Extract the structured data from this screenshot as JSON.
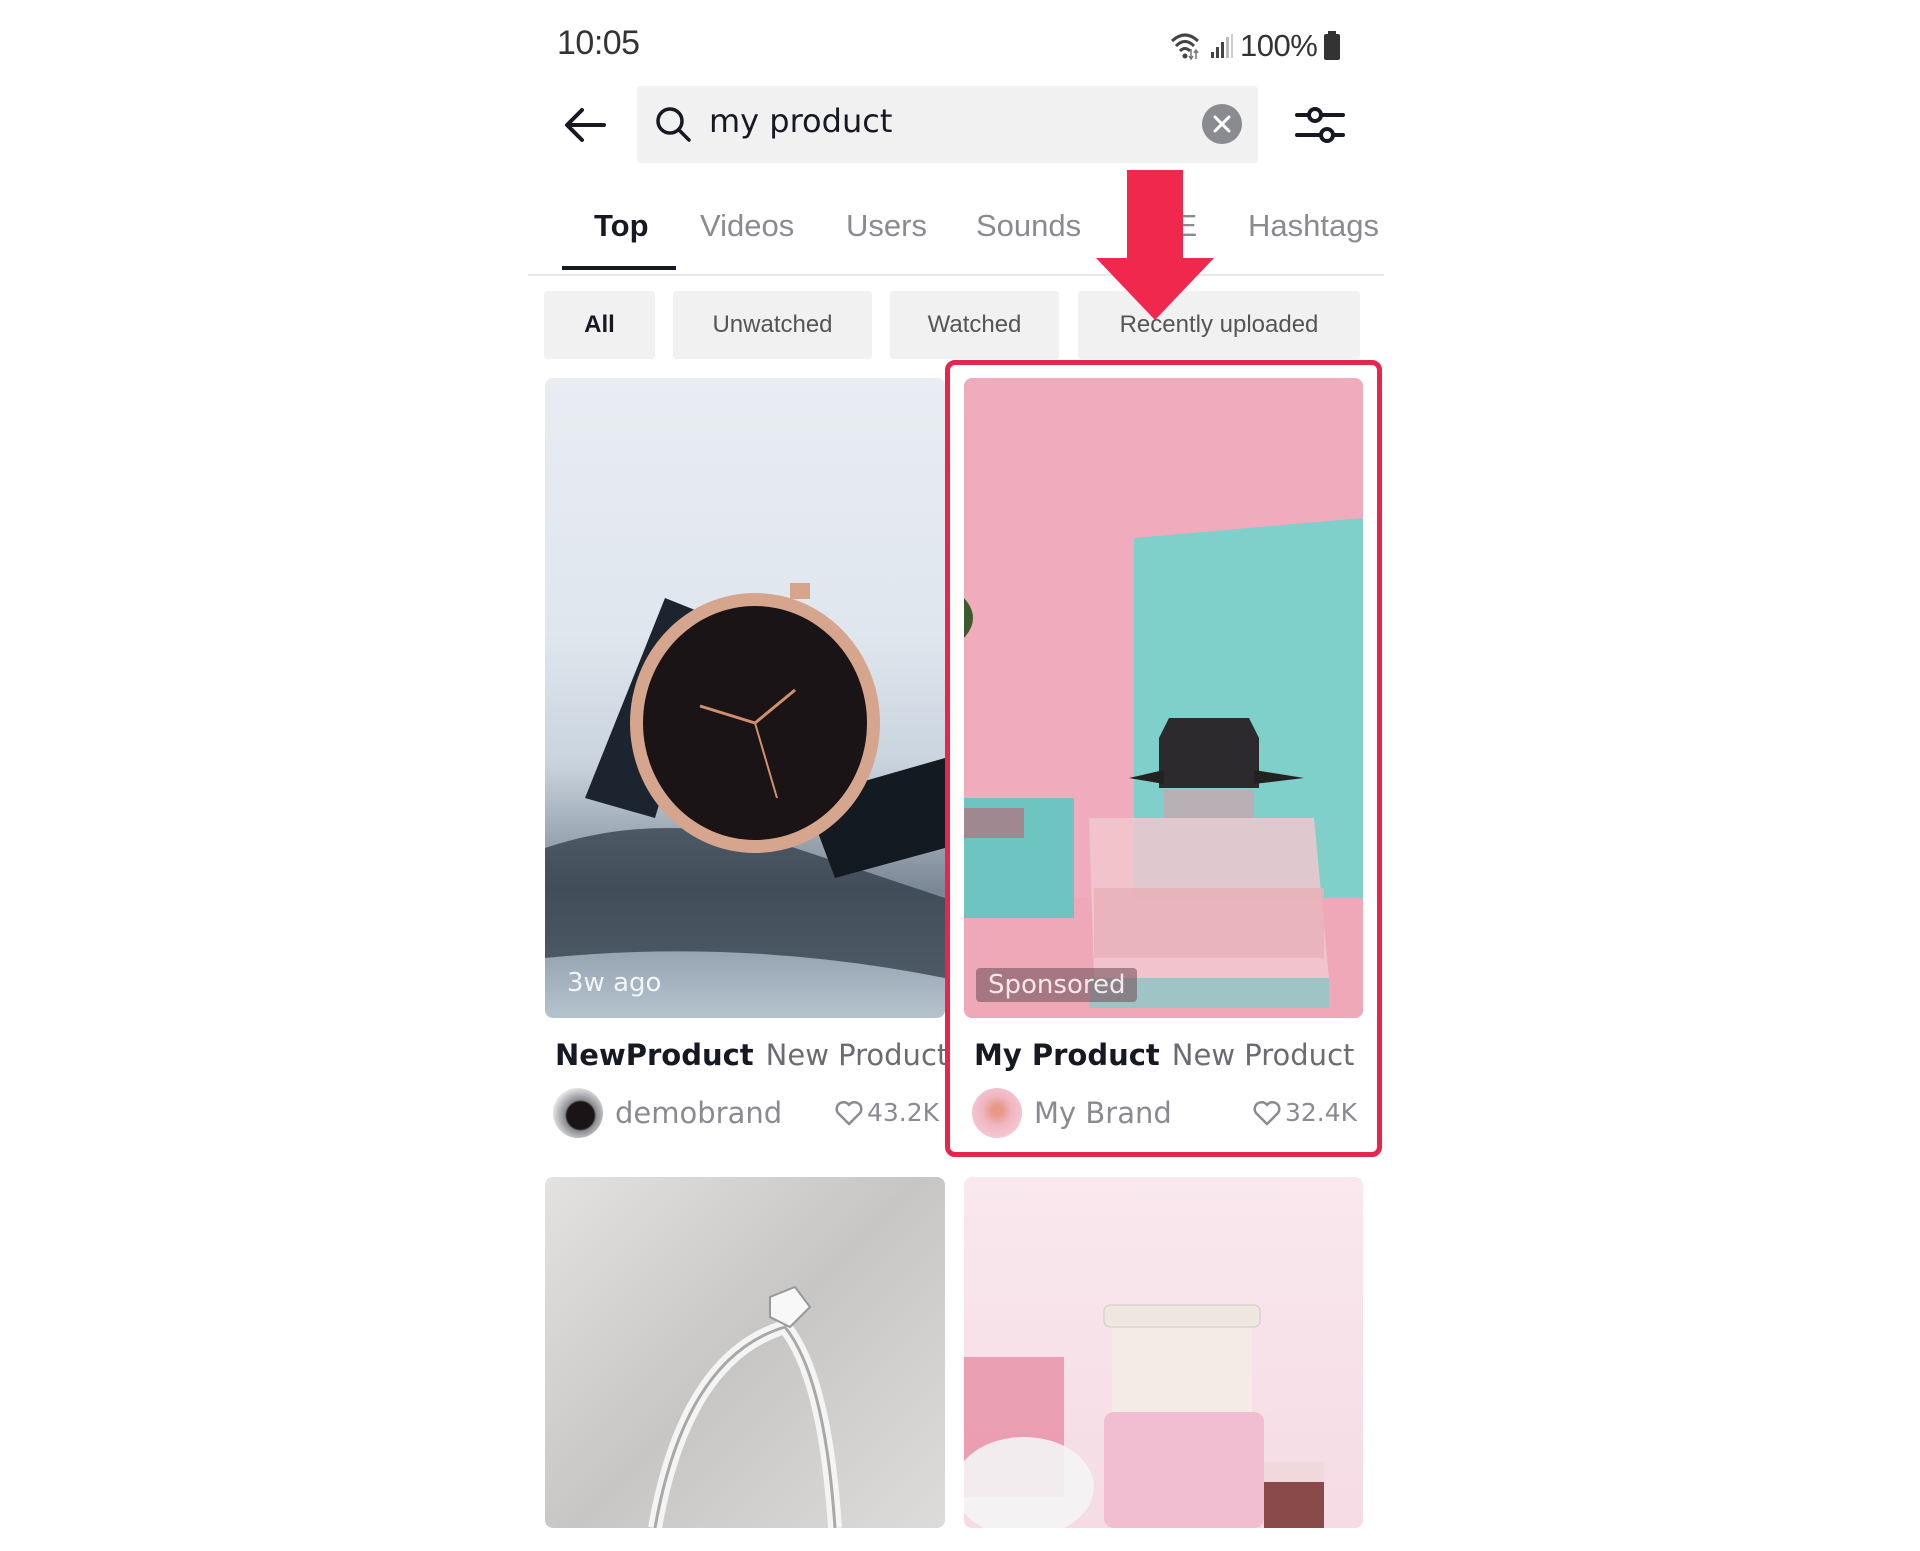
{
  "status_bar": {
    "time": "10:05",
    "battery_percent": "100%",
    "icons": [
      "wifi-icon",
      "signal-icon",
      "battery-icon"
    ]
  },
  "header": {
    "back_icon": "arrow-left-icon",
    "search": {
      "icon": "search-icon",
      "value": "my product",
      "clear_icon": "clear-icon"
    },
    "filter_icon": "sliders-icon"
  },
  "tabs": [
    {
      "label": "Top",
      "active": true
    },
    {
      "label": "Videos",
      "active": false
    },
    {
      "label": "Users",
      "active": false
    },
    {
      "label": "Sounds",
      "active": false
    },
    {
      "label": "LIVE",
      "active": false
    },
    {
      "label": "Hashtags",
      "active": false
    }
  ],
  "chips": [
    {
      "label": "All",
      "active": true
    },
    {
      "label": "Unwatched",
      "active": false
    },
    {
      "label": "Watched",
      "active": false
    },
    {
      "label": "Recently uploaded",
      "active": false
    }
  ],
  "annotation": {
    "arrow_color": "#f0284e",
    "highlight_color": "#e6264f"
  },
  "results": [
    {
      "title": "NewProduct",
      "subtitle": "New Product",
      "brand": "demobrand",
      "likes": "43.2K",
      "overlay": "3w ago",
      "image": "watch"
    },
    {
      "title": "My Product",
      "subtitle": "New Product",
      "brand": "My Brand",
      "likes": "32.4K",
      "overlay": "Sponsored",
      "image": "perfume",
      "highlighted": true
    },
    {
      "image": "ring"
    },
    {
      "image": "pink-bottle"
    }
  ]
}
